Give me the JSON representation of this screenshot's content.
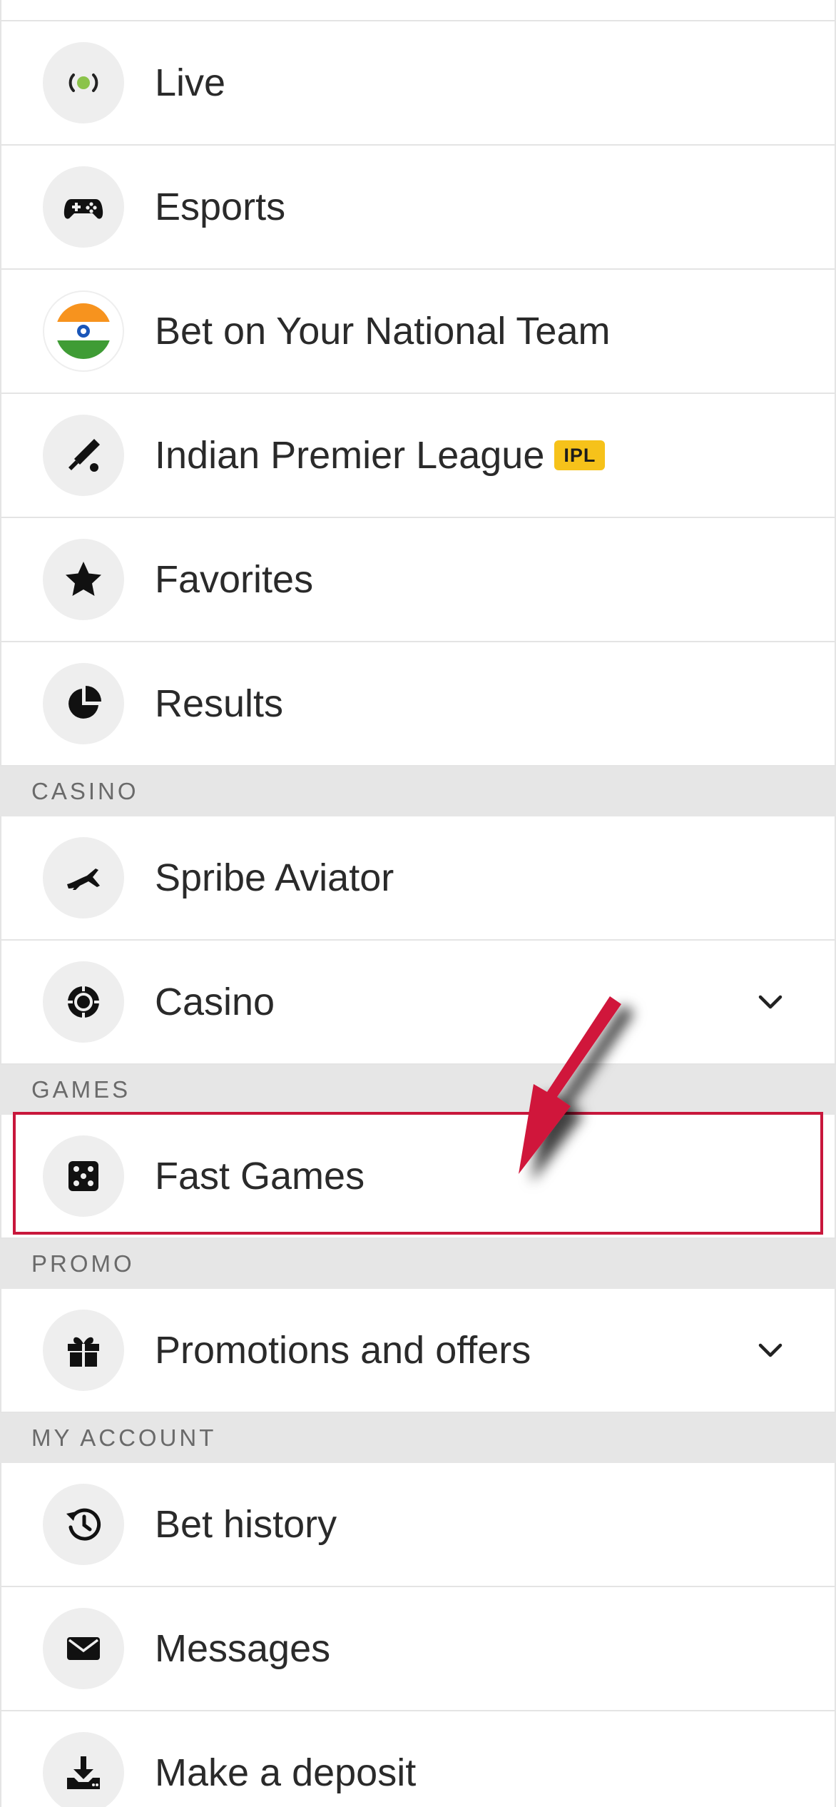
{
  "menu": {
    "items_top": [
      {
        "label": "Live",
        "icon": "live-icon"
      },
      {
        "label": "Esports",
        "icon": "gamepad-icon"
      },
      {
        "label": "Bet on Your National Team",
        "icon": "india-flag-icon"
      },
      {
        "label": "Indian Premier League",
        "icon": "cricket-bat-icon",
        "badge": "IPL"
      },
      {
        "label": "Favorites",
        "icon": "star-icon"
      },
      {
        "label": "Results",
        "icon": "pie-chart-icon"
      }
    ],
    "sections": {
      "casino": "CASINO",
      "games": "GAMES",
      "promo": "PROMO",
      "account": "MY ACCOUNT"
    },
    "casino_items": [
      {
        "label": "Spribe Aviator",
        "icon": "airplane-icon"
      },
      {
        "label": "Casino",
        "icon": "casino-chip-icon"
      }
    ],
    "games_items": [
      {
        "label": "Fast Games",
        "icon": "dice-icon"
      }
    ],
    "promo_items": [
      {
        "label": "Promotions and offers",
        "icon": "gift-icon"
      }
    ],
    "account_items": [
      {
        "label": "Bet history",
        "icon": "history-icon"
      },
      {
        "label": "Messages",
        "icon": "envelope-icon"
      },
      {
        "label": "Make a deposit",
        "icon": "download-icon"
      }
    ]
  },
  "colors": {
    "live_green": "#8bc34a",
    "badge_yellow": "#f6c21a",
    "highlight_red": "#c8173c",
    "section_bg": "#e6e6e6"
  }
}
